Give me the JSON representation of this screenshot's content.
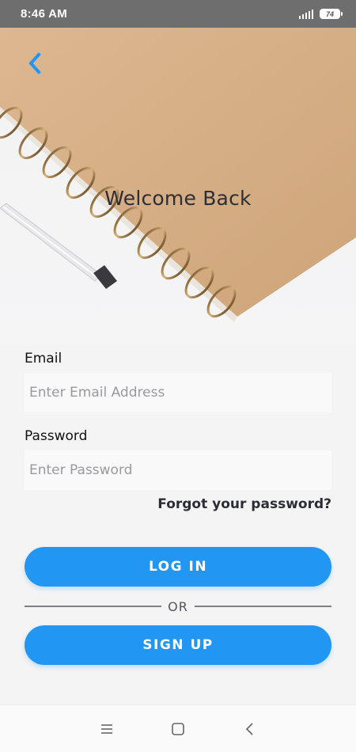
{
  "status_bar": {
    "time": "8:46 AM",
    "battery_level": "74",
    "icons": [
      "signal-icon",
      "battery-icon"
    ]
  },
  "header": {
    "back_icon": "chevron-left-icon",
    "title": "Welcome Back",
    "accent_color": "#2196f3"
  },
  "form": {
    "email": {
      "label": "Email",
      "placeholder": "Enter Email Address",
      "value": ""
    },
    "password": {
      "label": "Password",
      "placeholder": "Enter Password",
      "value": ""
    },
    "forgot_link": "Forgot your password?",
    "login_label": "LOG IN",
    "divider_text": "OR",
    "signup_label": "SIGN UP"
  },
  "nav_bar": {
    "icons": [
      "menu-icon",
      "home-square-icon",
      "back-triangle-icon"
    ]
  }
}
